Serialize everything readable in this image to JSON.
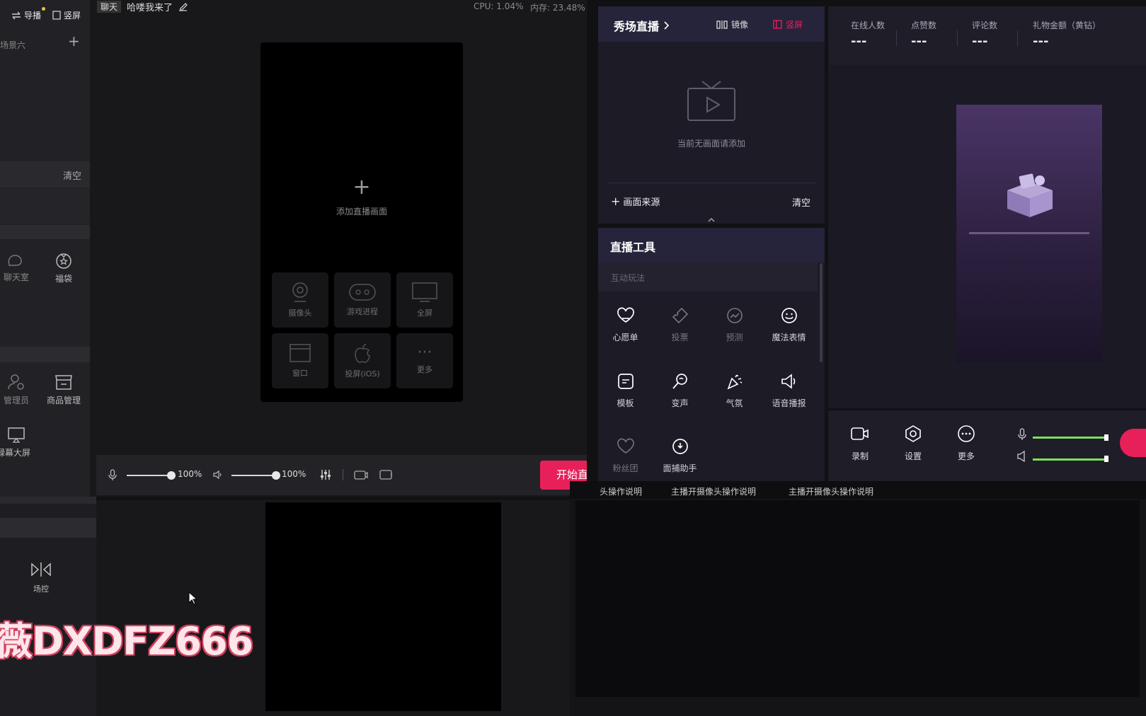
{
  "topbar": {
    "nav_director": "导播",
    "nav_portrait": "竖屏",
    "tag_chat": "聊天",
    "title": "哈喽我来了",
    "cpu": "CPU: 1.04%",
    "mem": "内存: 23.48%"
  },
  "left": {
    "scene": "场景六",
    "clear": "清空",
    "items": {
      "chatroom": "聊天室",
      "luckybag": "福袋",
      "admin": "管理员",
      "goods": "商品管理",
      "greenscreen": "绿幕大屏"
    }
  },
  "canvas": {
    "add_label": "添加直播画面",
    "sources": [
      "摄像头",
      "游戏进程",
      "全屏",
      "窗口",
      "投屏(iOS)",
      "更多"
    ]
  },
  "controls": {
    "mic_pct": "100%",
    "spk_pct": "100%",
    "mic_level": 1.0,
    "spk_level": 1.0,
    "start_btn": "开始直"
  },
  "right_panel": {
    "title": "秀场直播",
    "mirror": "镜像",
    "portrait": "竖屏",
    "empty": "当前无画面请添加",
    "add_source": "画面来源",
    "clear": "清空"
  },
  "tools": {
    "title": "直播工具",
    "section": "互动玩法",
    "items": [
      {
        "label": "心愿单",
        "icon": "heart-icon"
      },
      {
        "label": "投票",
        "icon": "ticket-icon"
      },
      {
        "label": "预测",
        "icon": "predict-icon"
      },
      {
        "label": "魔法表情",
        "icon": "smile-icon"
      },
      {
        "label": "模板",
        "icon": "template-icon"
      },
      {
        "label": "变声",
        "icon": "voice-change-icon"
      },
      {
        "label": "气氛",
        "icon": "party-icon"
      },
      {
        "label": "语音播报",
        "icon": "speaker-icon"
      },
      {
        "label": "粉丝团",
        "icon": "fan-heart-icon"
      },
      {
        "label": "面捕助手",
        "icon": "face-capture-icon"
      }
    ]
  },
  "stats": {
    "online_label": "在线人数",
    "online_value": "---",
    "likes_label": "点赞数",
    "likes_value": "---",
    "comments_label": "评论数",
    "comments_value": "---",
    "gifts_label": "礼物金额（黄钻）",
    "gifts_value": "---"
  },
  "preview_bar": {
    "record": "录制",
    "settings": "设置",
    "more": "更多"
  },
  "tutorial_tabs": [
    "头操作说明",
    "主播开摄像头操作说明",
    "主播开摄像头操作说明"
  ],
  "bottom": {
    "scene_ctrl": "场控",
    "watermark": "薇DXDFZ666"
  },
  "colors": {
    "accent_pink": "#e8205a",
    "panel_bg": "#1c1b26",
    "green_slider": "#7ce05a"
  }
}
